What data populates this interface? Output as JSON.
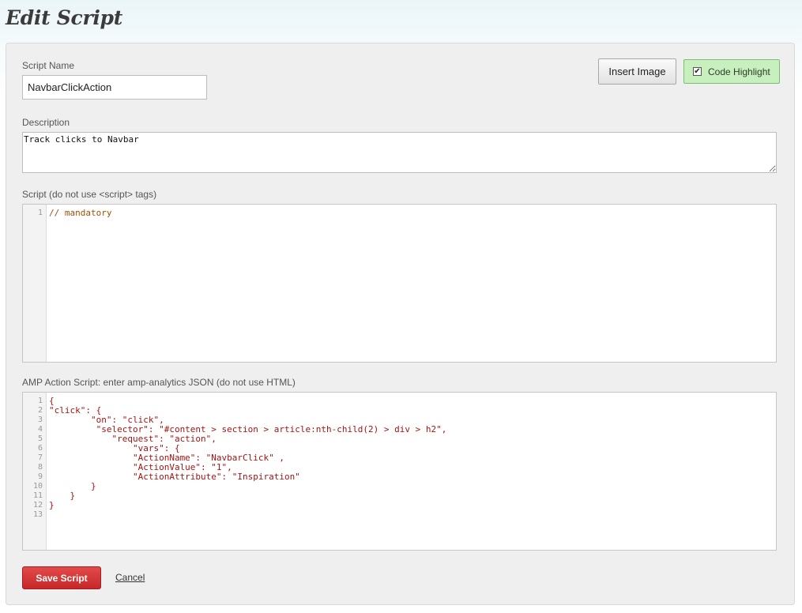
{
  "page": {
    "title": "Edit Script"
  },
  "form": {
    "script_name_label": "Script Name",
    "script_name_value": "NavbarClickAction",
    "description_label": "Description",
    "description_value": "Track clicks to Navbar",
    "script_label": "Script (do not use <script> tags)",
    "amp_label": "AMP Action Script: enter amp-analytics JSON (do not use HTML)"
  },
  "toolbar": {
    "insert_image_label": "Insert Image",
    "code_highlight_label": "Code Highlight",
    "code_highlight_checked": true
  },
  "script_editor": {
    "lines": [
      "// mandatory"
    ]
  },
  "amp_editor": {
    "lines": [
      "{",
      "\"click\": {",
      "        \"on\": \"click\",",
      "         \"selector\": \"#content > section > article:nth-child(2) > div > h2\",",
      "            \"request\": \"action\",",
      "                \"vars\": {",
      "                \"ActionName\": \"NavbarClick\" ,",
      "                \"ActionValue\": \"1\",",
      "                \"ActionAttribute\": \"Inspiration\"",
      "        }",
      "    }",
      "}",
      ""
    ]
  },
  "actions": {
    "save_label": "Save Script",
    "cancel_label": "Cancel"
  },
  "colors": {
    "save_button": "#d32f2f",
    "code_highlight_bg": "#c8f0bf",
    "code_string": "#aa1111",
    "code_comment": "#a05000"
  }
}
